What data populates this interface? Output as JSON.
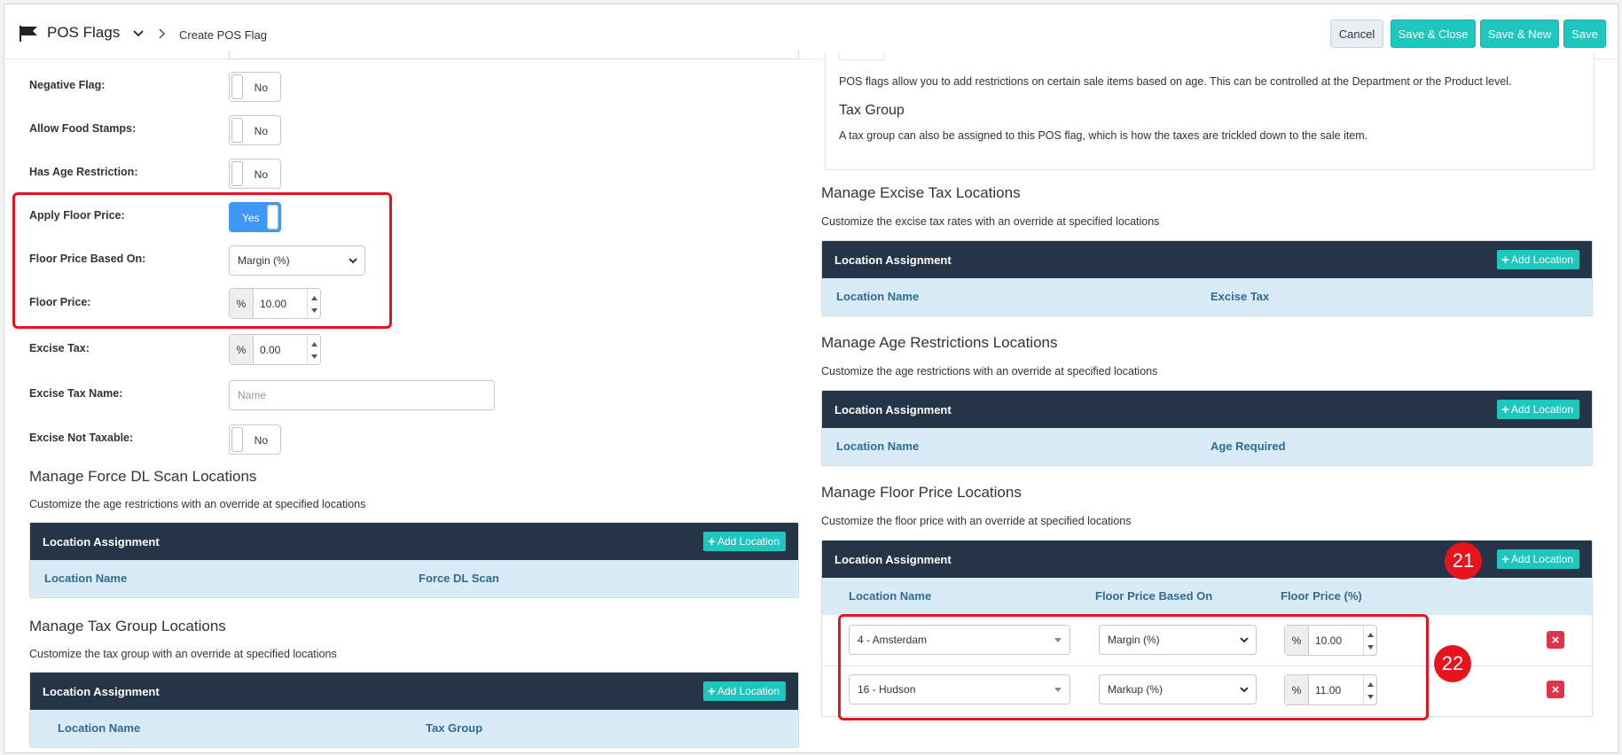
{
  "header": {
    "title": "POS Flags",
    "breadcrumb": "Create POS Flag",
    "buttons": {
      "cancel": "Cancel",
      "save_close": "Save & Close",
      "save_new": "Save & New",
      "save": "Save"
    }
  },
  "form": {
    "negative_flag": {
      "label": "Negative Flag:",
      "value": "No"
    },
    "allow_food_stamps": {
      "label": "Allow Food Stamps:",
      "value": "No"
    },
    "has_age_restriction": {
      "label": "Has Age Restriction:",
      "value": "No"
    },
    "apply_floor_price": {
      "label": "Apply Floor Price:",
      "value": "Yes"
    },
    "floor_price_based_on": {
      "label": "Floor Price Based On:",
      "value": "Margin (%)"
    },
    "floor_price": {
      "label": "Floor Price:",
      "prefix": "%",
      "value": "10.00"
    },
    "excise_tax": {
      "label": "Excise Tax:",
      "prefix": "%",
      "value": "0.00"
    },
    "excise_tax_name": {
      "label": "Excise Tax Name:",
      "placeholder": "Name"
    },
    "excise_not_taxable": {
      "label": "Excise Not Taxable:",
      "value": "No"
    }
  },
  "info": {
    "pos_flags_text": "POS flags allow you to add restrictions on certain sale items based on age. This can be controlled at the Department or the Product level.",
    "tax_group_title": "Tax Group",
    "tax_group_text": "A tax group can also be assigned to this POS flag, which is how the taxes are trickled down to the sale item."
  },
  "sections": {
    "force_dl": {
      "title": "Manage Force DL Scan Locations",
      "subtitle": "Customize the age restrictions with an override at specified locations",
      "panel_title": "Location Assignment",
      "add_label": "Add Location",
      "col1": "Location Name",
      "col2": "Force DL Scan"
    },
    "tax_group": {
      "title": "Manage Tax Group Locations",
      "subtitle": "Customize the tax group with an override at specified locations",
      "panel_title": "Location Assignment",
      "add_label": "Add Location",
      "col1": "Location Name",
      "col2": "Tax Group"
    },
    "excise": {
      "title": "Manage Excise Tax Locations",
      "subtitle": "Customize the excise tax rates with an override at specified locations",
      "panel_title": "Location Assignment",
      "add_label": "Add Location",
      "col1": "Location Name",
      "col2": "Excise Tax"
    },
    "age": {
      "title": "Manage Age Restrictions Locations",
      "subtitle": "Customize the age restrictions with an override at specified locations",
      "panel_title": "Location Assignment",
      "add_label": "Add Location",
      "col1": "Location Name",
      "col2": "Age Required"
    },
    "floor": {
      "title": "Manage Floor Price Locations",
      "subtitle": "Customize the floor price with an override at specified locations",
      "panel_title": "Location Assignment",
      "add_label": "Add Location",
      "col1": "Location Name",
      "col2": "Floor Price Based On",
      "col3": "Floor Price (%)",
      "rows": [
        {
          "location": "4 - Amsterdam",
          "based_on": "Margin (%)",
          "prefix": "%",
          "price": "10.00"
        },
        {
          "location": "16 - Hudson",
          "based_on": "Markup (%)",
          "prefix": "%",
          "price": "11.00"
        }
      ]
    }
  },
  "annotations": {
    "badge1": "21",
    "badge2": "22"
  },
  "colors": {
    "teal": "#1ec6be",
    "navy": "#253447",
    "highlight": "#e8141d",
    "toggle_on": "#3d99f5"
  }
}
